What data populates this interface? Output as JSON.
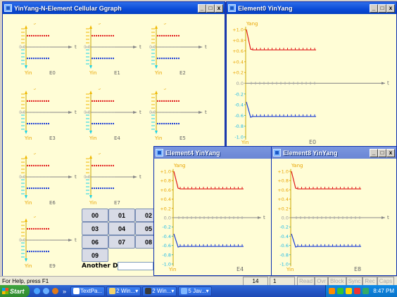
{
  "main_window": {
    "title": "YinYang-N-Element Cellular Ggraph",
    "min": "_",
    "max": "□",
    "close": "x",
    "cells": [
      {
        "label": "E0"
      },
      {
        "label": "E1"
      },
      {
        "label": "E2"
      },
      {
        "label": "E3"
      },
      {
        "label": "E4"
      },
      {
        "label": "E5"
      },
      {
        "label": "E6"
      },
      {
        "label": "E7"
      },
      {
        "label": "E9"
      }
    ],
    "yang_label": "Yang",
    "yin_label": "Yin",
    "t_label": "t",
    "grid_buttons": [
      "00",
      "01",
      "02",
      "03",
      "04",
      "05",
      "06",
      "07",
      "08",
      "09"
    ],
    "another_label": "Another Da..."
  },
  "popups": [
    {
      "title": "Element0 YinYang",
      "label": "E0",
      "yang_level": 0.62,
      "yin_level": -0.62
    },
    {
      "title": "Element4 YinYang",
      "label": "E4",
      "yang_level": 0.62,
      "yin_level": -0.62
    },
    {
      "title": "Element8 YinYang",
      "label": "E8",
      "yang_level": 0.62,
      "yin_level": -0.62
    }
  ],
  "y_ticks": [
    "+1.0",
    "+0.8",
    "+0.6",
    "+0.4",
    "+0.2",
    "0.0",
    "-0.2",
    "-0.4",
    "-0.6",
    "-0.8",
    "-1.0"
  ],
  "status": {
    "help": "For Help, press F1",
    "num1": "14",
    "num2": "1",
    "indicators": [
      "Read",
      "Ovr",
      "Block",
      "Sync",
      "Rec",
      "Caps"
    ]
  },
  "taskbar": {
    "start": "Start",
    "chev": "»",
    "items": [
      "TextPa...",
      "2 Win...",
      "2 Win...",
      "5 Jav..."
    ],
    "clock": "8:47 PM"
  },
  "colors": {
    "yang": "#e8a400",
    "red": "#e01818",
    "blue": "#1a3cd6",
    "cyan": "#19d3e6",
    "axis": "#888888"
  }
}
